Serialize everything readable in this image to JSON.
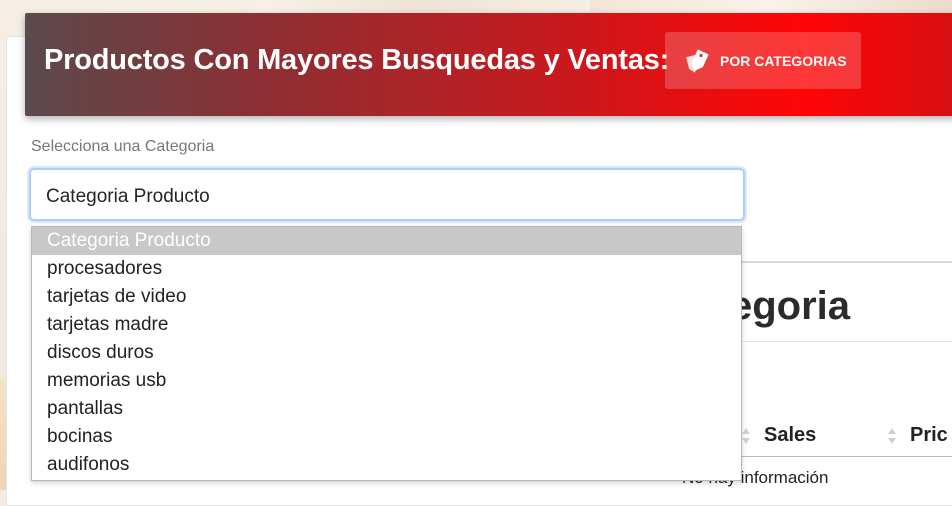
{
  "banner": {
    "title": "Productos Con Mayores Busquedas y Ventas:",
    "category_button": {
      "label": "POR CATEGORIAS",
      "icon": "tags-icon"
    },
    "gradient_colors": [
      "#5b4a4c",
      "#c41b1f",
      "#ff0505"
    ]
  },
  "category_select": {
    "label": "Selecciona una Categoria",
    "value": "Categoria Producto",
    "options": [
      "Categoria Producto",
      "procesadores",
      "tarjetas de video",
      "tarjetas madre",
      "discos duros",
      "memorias usb",
      "pantallas",
      "bocinas",
      "audifonos"
    ],
    "highlighted_index": 0,
    "focus_color": "#aecdf8"
  },
  "results_panel": {
    "heading_fragment": "egoria",
    "columns": [
      "Sales",
      "Pric"
    ],
    "empty_message": "No hay información"
  }
}
